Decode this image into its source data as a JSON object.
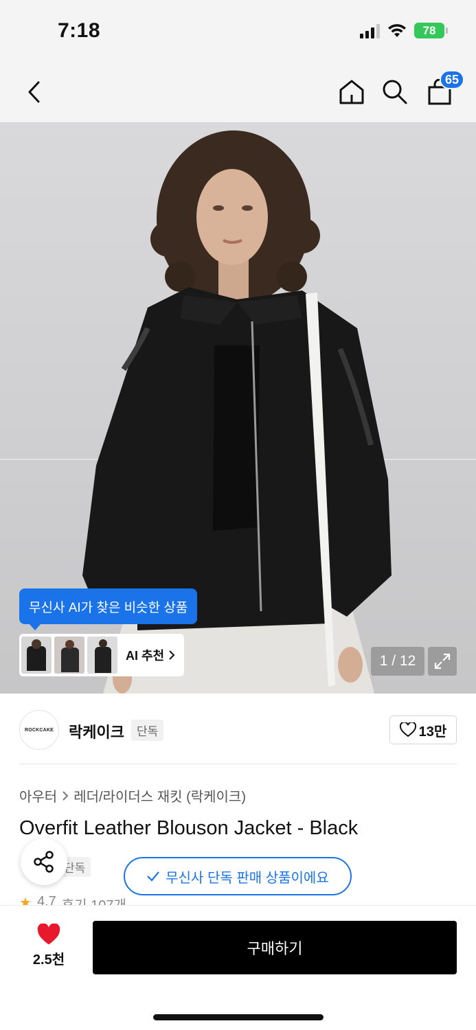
{
  "status_bar": {
    "time": "7:18",
    "battery": "78"
  },
  "nav": {
    "cart_badge": "65"
  },
  "gallery": {
    "ai_tooltip": "무신사 AI가 찾은 비슷한 상품",
    "ai_recommend_label": "AI 추천",
    "page_indicator": "1 / 12"
  },
  "brand": {
    "logo_text": "ROCKCAKE",
    "name": "락케이크",
    "tag": "단독",
    "like_count": "13만"
  },
  "product": {
    "breadcrumb": [
      "아우터",
      "레더/라이더스 재킷 (락케이크)"
    ],
    "title": "Overfit Leather Blouson Jacket - Black",
    "exclusive_tag": "단독",
    "exclusive_pill": "무신사 단독 판매 상품이에요",
    "rating": "4.7",
    "reviews": "후기 107개"
  },
  "bottom_bar": {
    "wish_count": "2.5천",
    "buy_label": "구매하기"
  },
  "colors": {
    "accent": "#1a73e8",
    "heart": "#e8192c",
    "battery": "#34c759"
  }
}
